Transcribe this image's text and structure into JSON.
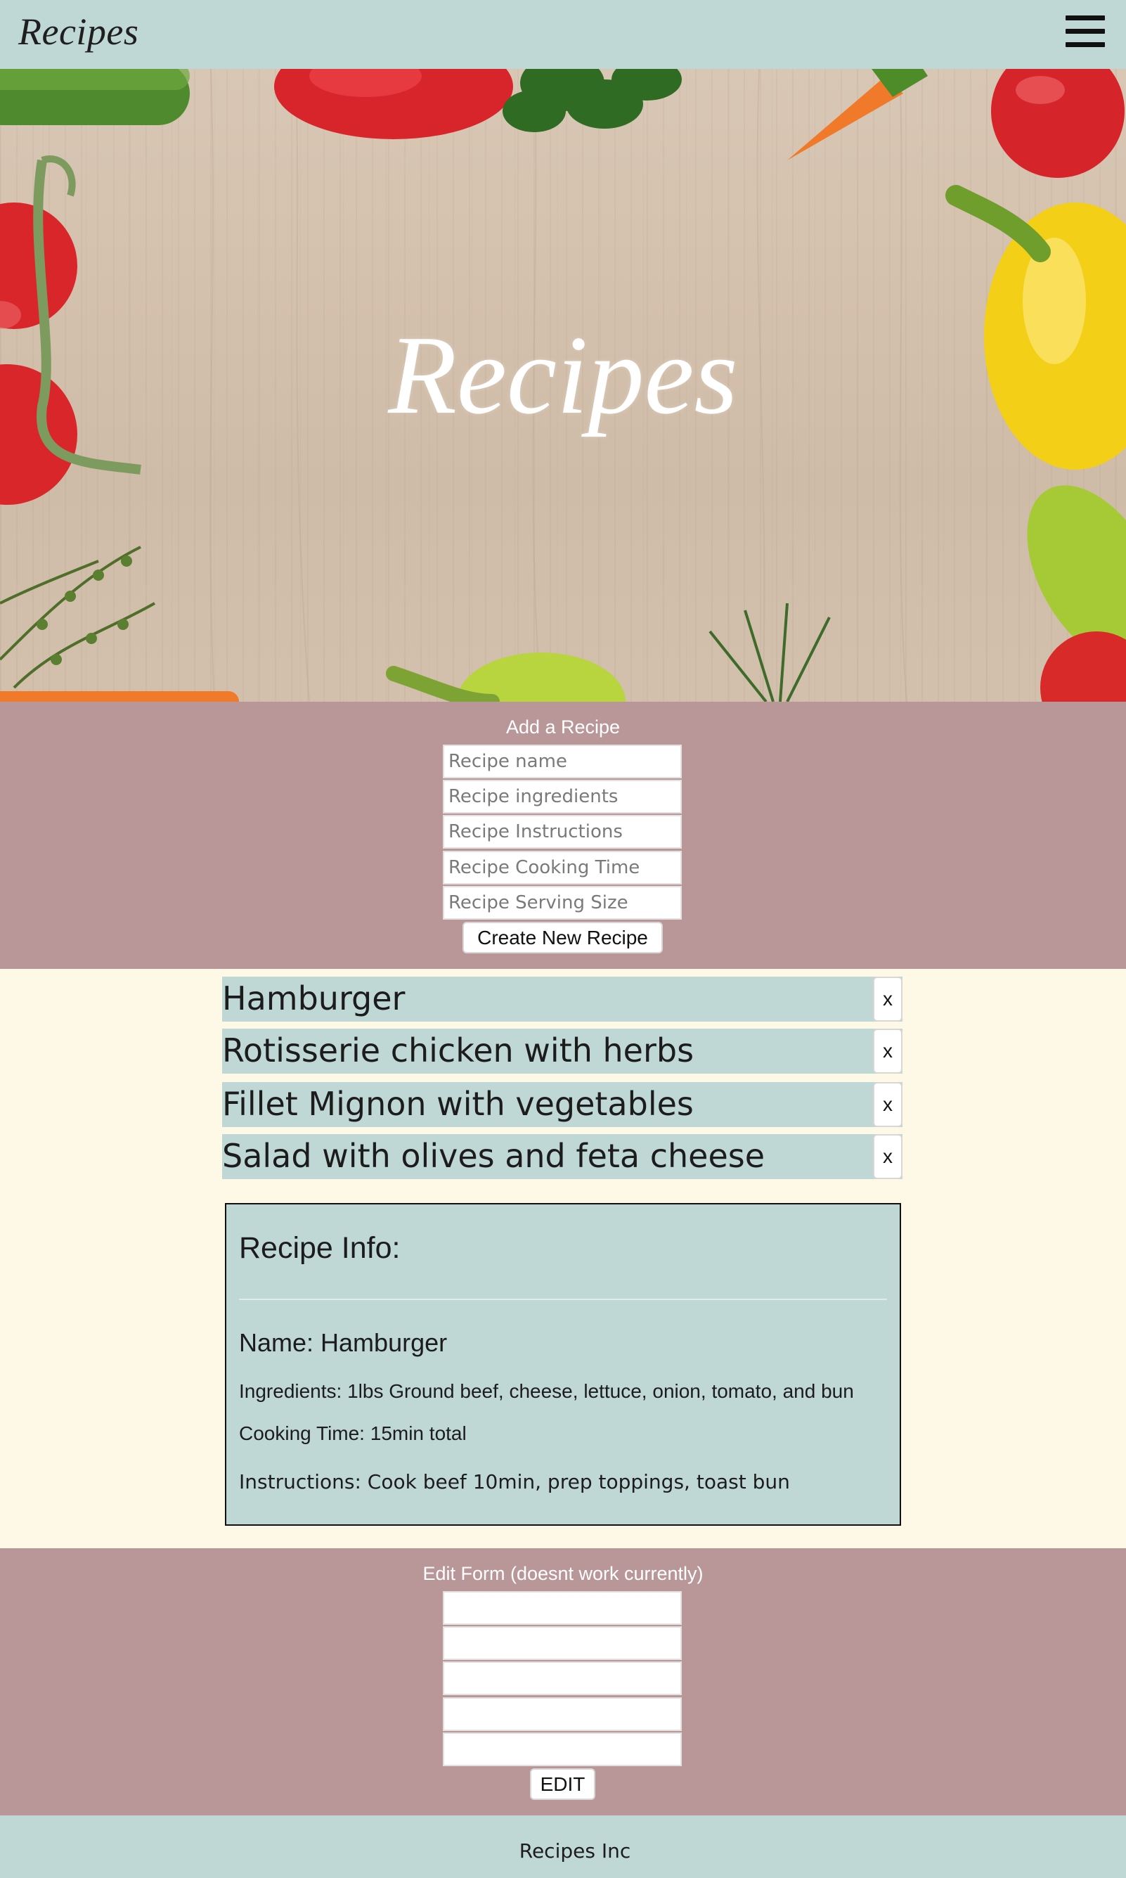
{
  "header": {
    "brand": "Recipes",
    "menu_icon": "hamburger-menu-icon"
  },
  "hero": {
    "title": "Recipes"
  },
  "add_form": {
    "heading": "Add a Recipe",
    "name_placeholder": "Recipe name",
    "ingredients_placeholder": "Recipe ingredients",
    "instructions_placeholder": "Recipe Instructions",
    "cooking_time_placeholder": "Recipe Cooking Time",
    "serving_size_placeholder": "Recipe Serving Size",
    "submit_label": "Create New Recipe"
  },
  "recipes": [
    {
      "name": "Hamburger",
      "delete_label": "x"
    },
    {
      "name": "Rotisserie chicken with herbs",
      "delete_label": "x"
    },
    {
      "name": "Fillet Mignon with vegetables",
      "delete_label": "x"
    },
    {
      "name": "Salad with olives and feta cheese",
      "delete_label": "x"
    }
  ],
  "recipe_info": {
    "title": "Recipe Info:",
    "name": "Name: Hamburger",
    "ingredients": "Ingredients: 1lbs Ground beef, cheese, lettuce, onion, tomato, and bun",
    "cooking_time": "Cooking Time: 15min total",
    "instructions": "Instructions: Cook beef 10min, prep toppings, toast bun"
  },
  "edit_form": {
    "heading": "Edit Form (doesnt work currently)",
    "submit_label": "EDIT"
  },
  "footer": {
    "text": "Recipes Inc"
  },
  "colors": {
    "header_bg": "#bfd8d5",
    "form_section_bg": "#b99799",
    "page_bg": "#fdf9e6",
    "card_bg": "#bfd8d5"
  }
}
